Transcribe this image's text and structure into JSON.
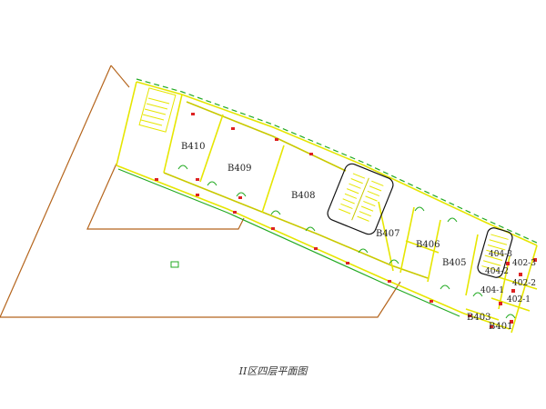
{
  "caption": "II区四层平面图",
  "colors": {
    "site_outline": "#b5651d",
    "wall": "#e6e600",
    "wall_dark": "#c9c900",
    "green_line": "#22aa22",
    "red_mark": "#dd2222",
    "stair_frame": "#111111",
    "room_text": "#222222",
    "background": "#ffffff"
  },
  "rooms": {
    "b410": "B410",
    "b409": "B409",
    "b408": "B408",
    "b407": "B407",
    "b406": "B406",
    "b405": "B405",
    "b404_3": "404-3",
    "b402_3": "402-3",
    "b404_2": "404-2",
    "b402_2": "402-2",
    "b404_1": "404-1",
    "b402_1": "402-1",
    "b403": "B403",
    "b401": "B401"
  }
}
